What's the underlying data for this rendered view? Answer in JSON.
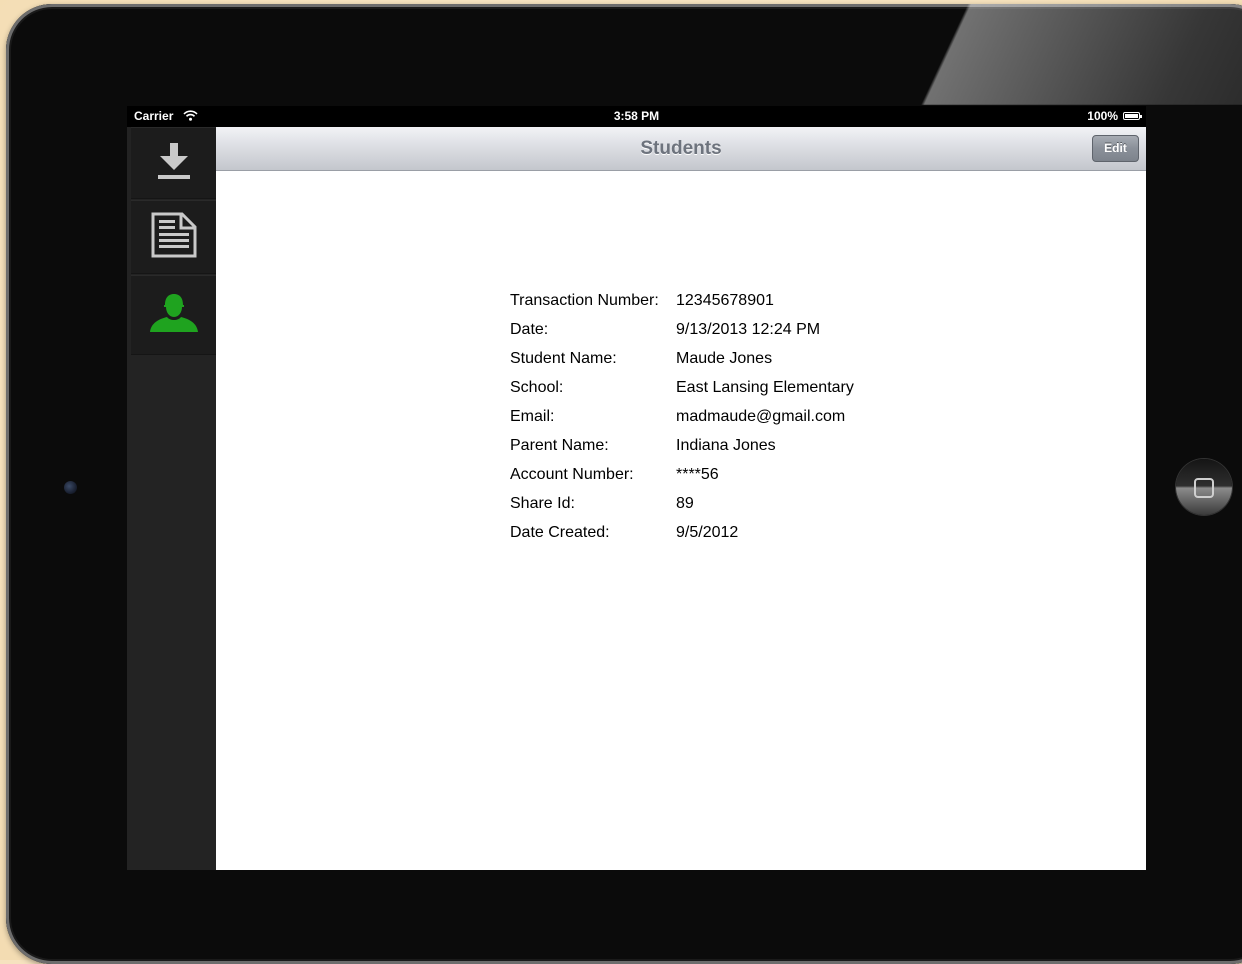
{
  "status_bar": {
    "carrier": "Carrier",
    "time": "3:58 PM",
    "battery": "100%"
  },
  "navbar": {
    "title": "Students",
    "edit_label": "Edit"
  },
  "sidebar": {
    "items": [
      {
        "icon": "download-icon",
        "color": "#c9c9c9"
      },
      {
        "icon": "document-icon",
        "color": "#c9c9c9"
      },
      {
        "icon": "person-icon",
        "color": "#1fa31f"
      }
    ]
  },
  "details": [
    {
      "label": "Transaction Number:",
      "value": "12345678901"
    },
    {
      "label": "Date:",
      "value": "9/13/2013 12:24 PM"
    },
    {
      "label": "Student Name:",
      "value": "Maude Jones"
    },
    {
      "label": "School:",
      "value": "East Lansing Elementary"
    },
    {
      "label": "Email:",
      "value": "madmaude@gmail.com"
    },
    {
      "label": "Parent Name:",
      "value": "Indiana Jones"
    },
    {
      "label": "Account Number:",
      "value": "****56"
    },
    {
      "label": "Share Id:",
      "value": "89"
    },
    {
      "label": "Date Created:",
      "value": "9/5/2012"
    }
  ]
}
